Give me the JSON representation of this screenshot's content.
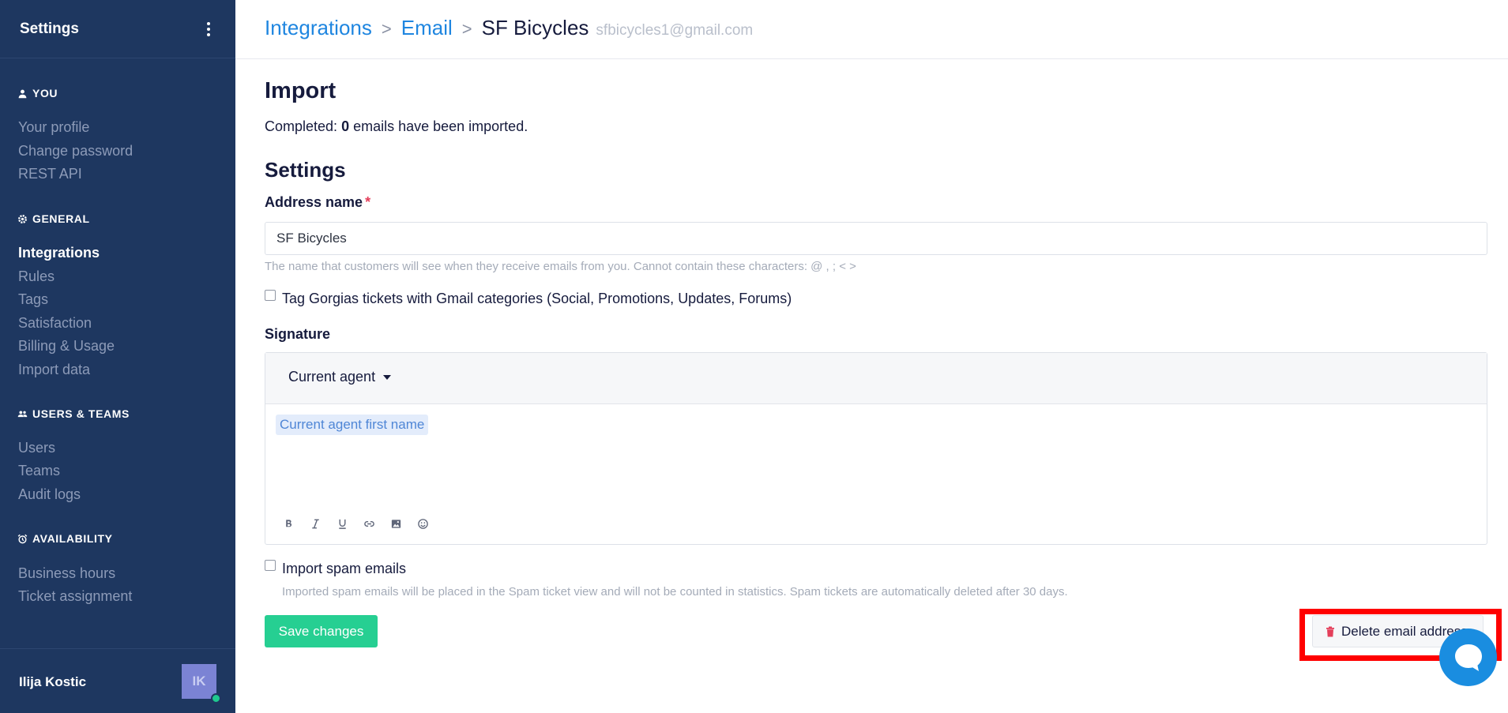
{
  "sidebar": {
    "title": "Settings",
    "sections": [
      {
        "title": "YOU",
        "icon": "person-icon",
        "items": [
          "Your profile",
          "Change password",
          "REST API"
        ]
      },
      {
        "title": "GENERAL",
        "icon": "gear-icon",
        "items": [
          "Integrations",
          "Rules",
          "Tags",
          "Satisfaction",
          "Billing & Usage",
          "Import data"
        ]
      },
      {
        "title": "USERS & TEAMS",
        "icon": "users-icon",
        "items": [
          "Users",
          "Teams",
          "Audit logs"
        ]
      },
      {
        "title": "AVAILABILITY",
        "icon": "alarm-clock-icon",
        "items": [
          "Business hours",
          "Ticket assignment"
        ]
      }
    ],
    "active_item": "Integrations",
    "user": {
      "name": "Ilija Kostic",
      "initials": "IK",
      "status_color": "#1fc98f"
    }
  },
  "breadcrumb": {
    "items": [
      "Integrations",
      "Email"
    ],
    "current": "SF Bicycles",
    "email": "sfbicycles1@gmail.com"
  },
  "import": {
    "title": "Import",
    "status_prefix": "Completed: ",
    "count": "0",
    "status_suffix": " emails have been imported."
  },
  "settings": {
    "title": "Settings",
    "address_name": {
      "label": "Address name",
      "required_mark": "*",
      "value": "SF Bicycles",
      "help": "The name that customers will see when they receive emails from you. Cannot contain these characters: @ , ; < >"
    },
    "tag_gmail": {
      "label": "Tag Gorgias tickets with Gmail categories (Social, Promotions, Updates, Forums)",
      "checked": false
    },
    "signature": {
      "label": "Signature",
      "dropdown": "Current agent",
      "variable_chip": "Current agent first name",
      "toolbar": [
        "bold-icon",
        "italic-icon",
        "underline-icon",
        "link-icon",
        "image-icon",
        "emoji-icon"
      ]
    },
    "import_spam": {
      "label": "Import spam emails",
      "checked": false,
      "help": "Imported spam emails will be placed in the Spam ticket view and will not be counted in statistics. Spam tickets are automatically deleted after 30 days."
    },
    "save_label": "Save changes",
    "delete_label": "Delete email address"
  },
  "colors": {
    "sidebar_bg": "#1e3760",
    "link": "#1f86e0",
    "primary_green": "#26cf92",
    "danger": "#e43f5a",
    "highlight": "#ff0000",
    "chat": "#1a8de0"
  }
}
